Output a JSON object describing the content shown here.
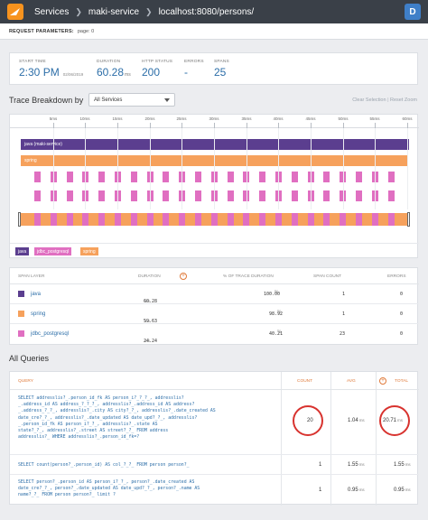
{
  "topbar": {
    "logo_icon": "solarwinds-logo-icon",
    "breadcrumbs": [
      "Services",
      "maki-service",
      "localhost:8080/persons/"
    ],
    "avatar": "D"
  },
  "request": {
    "label": "REQUEST PARAMETERS:",
    "value": "page: 0"
  },
  "summary": {
    "start": {
      "label": "START TIME",
      "value": "2:30 PM",
      "sub": "02/06/2019"
    },
    "duration": {
      "label": "DURATION",
      "value": "60.28",
      "unit": "ms"
    },
    "http": {
      "label": "HTTP STATUS",
      "value": "200"
    },
    "errors": {
      "label": "ERRORS",
      "value": "-"
    },
    "spans": {
      "label": "SPANS",
      "value": "25"
    }
  },
  "breakdown": {
    "title": "Trace Breakdown by",
    "select": "All Services",
    "clear": "Clear Selection",
    "divider": "|",
    "reset": "Reset Zoom",
    "ticks": [
      "5ms",
      "10ms",
      "15ms",
      "20ms",
      "25ms",
      "30ms",
      "35ms",
      "40ms",
      "45ms",
      "50ms",
      "55ms",
      "60ms"
    ],
    "bars": [
      {
        "label": "java (maki-service)",
        "color": "#5b3e8f"
      },
      {
        "label": "spring",
        "color": "#f6a15c"
      }
    ],
    "jdbc_color": "#e06fc1",
    "legend": [
      {
        "label": "java",
        "color": "#5b3e8f"
      },
      {
        "label": "jdbc_postgresql",
        "color": "#e06fc1"
      },
      {
        "label": "spring",
        "color": "#f6a15c"
      }
    ]
  },
  "layers": {
    "headers": [
      "SPAN LAYER",
      "DURATION",
      "% OF TRACE DURATION",
      "SPAN COUNT",
      "ERRORS"
    ],
    "rows": [
      {
        "name": "java",
        "color": "#5b3e8f",
        "duration": "60.28",
        "unit": "ms",
        "pct": "100.00",
        "count": "1",
        "errors": "0"
      },
      {
        "name": "spring",
        "color": "#f6a15c",
        "duration": "59.63",
        "unit": "ms",
        "pct": "98.92",
        "count": "1",
        "errors": "0"
      },
      {
        "name": "jdbc_postgresql",
        "color": "#e06fc1",
        "duration": "24.24",
        "unit": "ms",
        "pct": "40.21",
        "count": "23",
        "errors": "0"
      }
    ]
  },
  "queries": {
    "title": "All Queries",
    "headers": [
      "QUERY",
      "COUNT",
      "AVG",
      "TOTAL"
    ],
    "rows": [
      {
        "sql": "SELECT addresslis?_.person_id_fk AS person_i?_?_?_, addresslis?\n_.address_id AS address_?_?_?_, addresslis?_.address_id AS address?\n_.address_?_?_, addresslis?_.city AS city?_?_, addresslis?_.date_created AS\ndate_cre?_?_, addresslis?_.date_updated AS date_upd?_?_, addresslis?\n_.person_id_fk AS person_i?_?_, addresslis?_.state AS\nstate?_?_, addresslis?_.street AS street?_?_ FROM address\naddresslis?_ WHERE addresslis?_.person_id_fk=?",
        "count": "20",
        "avg": "1.04",
        "total": "20.71",
        "unit": "ms"
      },
      {
        "sql": "SELECT count(person?_.person_id) AS col_?_?_ FROM person person?_",
        "count": "1",
        "avg": "1.55",
        "total": "1.55",
        "unit": "ms"
      },
      {
        "sql": "SELECT person?_.person_id AS person_i?_?_, person?_.date_created AS\ndate_cre?_?_, person?_.date_updated AS date_upd?_?_, person?_.name AS\nname?_?_ FROM person person?_ limit ?",
        "count": "1",
        "avg": "0.95",
        "total": "0.95",
        "unit": "ms"
      }
    ]
  }
}
